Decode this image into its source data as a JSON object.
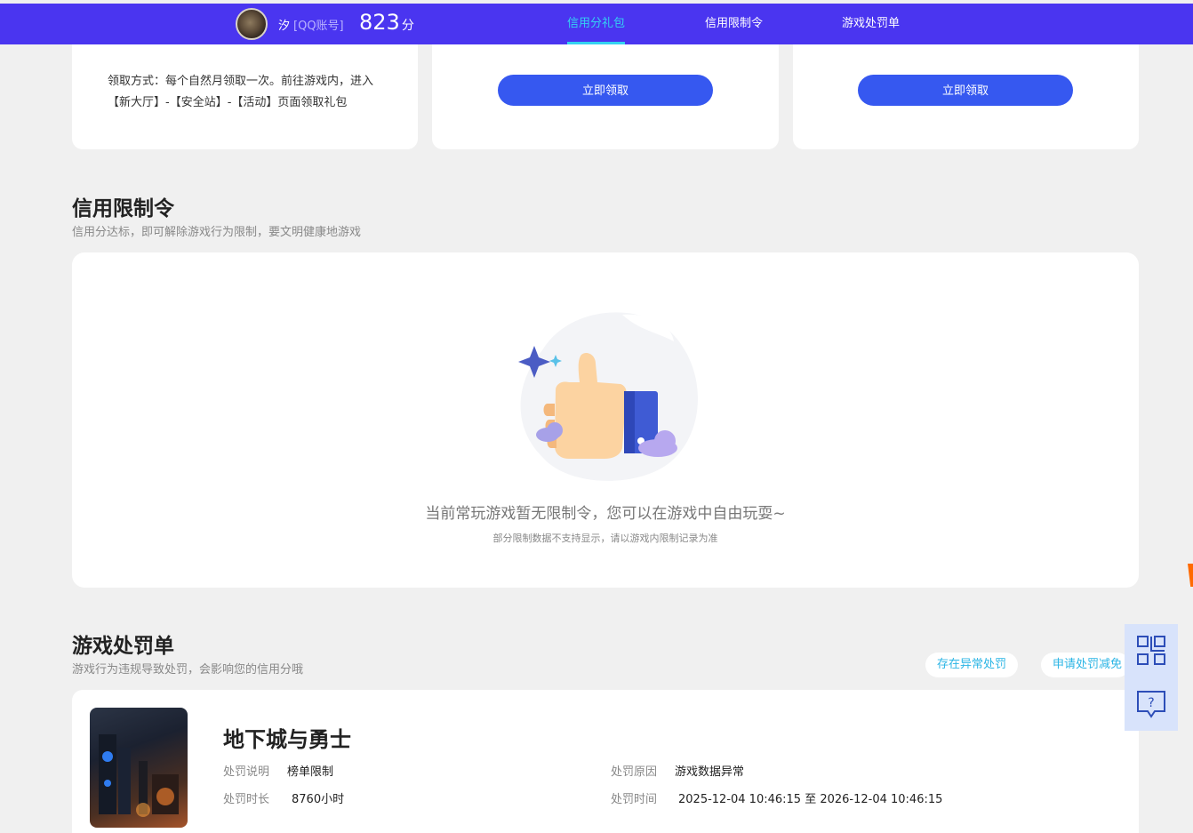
{
  "header": {
    "username": "汐",
    "account_type": "[QQ账号]",
    "score": "823",
    "score_unit": "分",
    "tabs": [
      {
        "label": "信用分礼包",
        "active": true
      },
      {
        "label": "信用限制令",
        "active": false
      },
      {
        "label": "游戏处罚单",
        "active": false
      }
    ],
    "accent_color": "#4a35f0",
    "active_tab_color": "#34d2f2"
  },
  "gift": {
    "claim_description": "领取方式：每个自然月领取一次。前往游戏内，进入【新大厅】-【安全站】-【活动】页面领取礼包",
    "claim_buttons": [
      "立即领取",
      "立即领取"
    ]
  },
  "restriction": {
    "title": "信用限制令",
    "subtitle": "信用分达标，即可解除游戏行为限制，要文明健康地游戏",
    "empty_message": "当前常玩游戏暂无限制令，您可以在游戏中自由玩耍~",
    "empty_note": "部分限制数据不支持显示，请以游戏内限制记录为准"
  },
  "penalty": {
    "title": "游戏处罚单",
    "subtitle": "游戏行为违规导致处罚，会影响您的信用分哦",
    "actions": [
      "存在异常处罚",
      "申请处罚减免"
    ],
    "items": [
      {
        "game": "地下城与勇士",
        "desc_label": "处罚说明",
        "desc_value": "榜单限制",
        "reason_label": "处罚原因",
        "reason_value": "游戏数据异常",
        "duration_label": "处罚时长",
        "duration_value": "8760小时",
        "time_label": "处罚时间",
        "time_value": "2025-12-04 10:46:15 至 2026-12-04 10:46:15"
      }
    ]
  },
  "side_tools": {
    "icons": [
      "qr-code-icon",
      "help-chat-icon"
    ]
  }
}
